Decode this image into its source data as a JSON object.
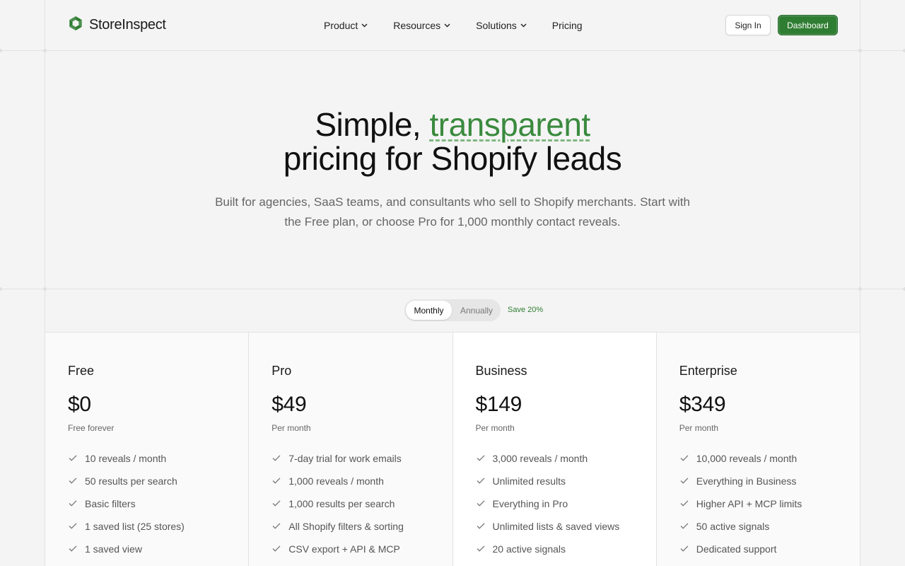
{
  "brand": {
    "name": "StoreInspect",
    "accent": "#2f7d32"
  },
  "nav": {
    "items": [
      {
        "label": "Product",
        "has_dropdown": true,
        "icon": "chevron-down-icon"
      },
      {
        "label": "Resources",
        "has_dropdown": true,
        "icon": "chevron-down-icon"
      },
      {
        "label": "Solutions",
        "has_dropdown": true,
        "icon": "chevron-down-icon"
      },
      {
        "label": "Pricing",
        "has_dropdown": false
      }
    ],
    "sign_in": "Sign In",
    "dashboard": "Dashboard"
  },
  "hero": {
    "title_before": "Simple, ",
    "title_accent": "transparent",
    "title_after": "pricing for Shopify leads",
    "subtitle": "Built for agencies, SaaS teams, and consultants who sell to Shopify merchants. Start with the Free plan, or choose Pro for 1,000 monthly contact reveals."
  },
  "billing": {
    "monthly": "Monthly",
    "annually": "Annually",
    "selected": "Monthly",
    "save_badge": "Save 20%"
  },
  "plans": [
    {
      "name": "Free",
      "price": "$0",
      "period": "Free forever",
      "features": [
        "10 reveals / month",
        "50 results per search",
        "Basic filters",
        "1 saved list (25 stores)",
        "1 saved view"
      ]
    },
    {
      "name": "Pro",
      "price": "$49",
      "period": "Per month",
      "features": [
        "7-day trial for work emails",
        "1,000 reveals / month",
        "1,000 results per search",
        "All Shopify filters & sorting",
        "CSV export + API & MCP"
      ]
    },
    {
      "name": "Business",
      "price": "$149",
      "period": "Per month",
      "features": [
        "3,000 reveals / month",
        "Unlimited results",
        "Everything in Pro",
        "Unlimited lists & saved views",
        "20 active signals"
      ]
    },
    {
      "name": "Enterprise",
      "price": "$349",
      "period": "Per month",
      "features": [
        "10,000 reveals / month",
        "Everything in Business",
        "Higher API + MCP limits",
        "50 active signals",
        "Dedicated support"
      ]
    }
  ]
}
